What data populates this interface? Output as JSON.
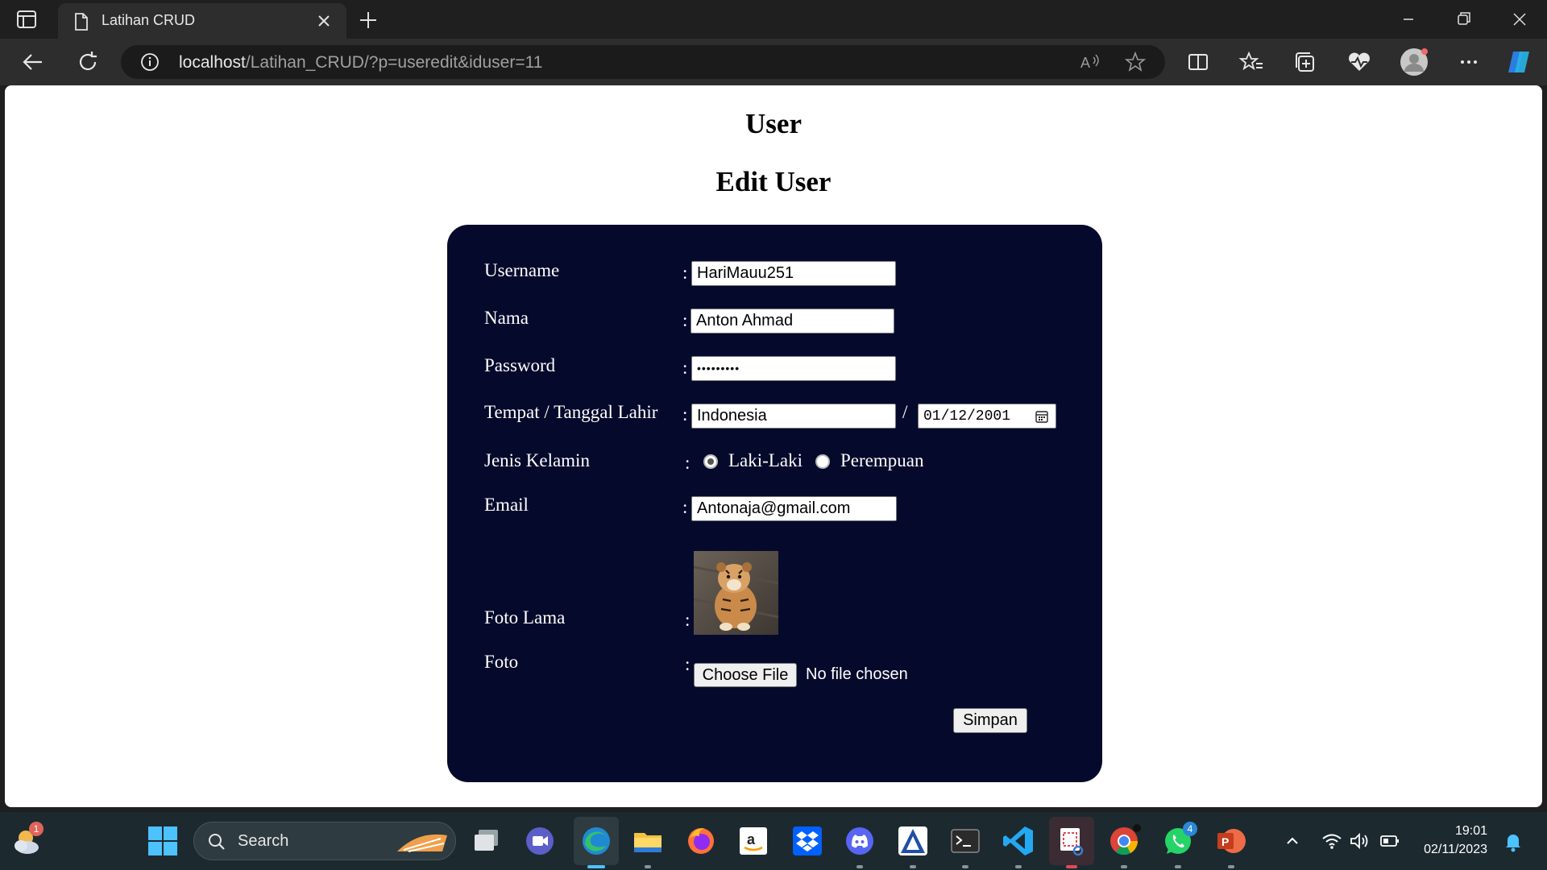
{
  "browser": {
    "tab_title": "Latihan CRUD",
    "url_host": "localhost",
    "url_rest": "/Latihan_CRUD/?p=useredit&iduser=11"
  },
  "page": {
    "heading": "User",
    "subheading": "Edit User"
  },
  "form": {
    "colon": ":",
    "username_label": "Username",
    "username_value": "HariMauu251",
    "nama_label": "Nama",
    "nama_value": "Anton Ahmad",
    "password_label": "Password",
    "password_value": "•••••••••",
    "ttl_label": "Tempat / Tanggal Lahir",
    "tempat_value": "Indonesia",
    "separator": "/",
    "tanggal_value": "01/12/2001",
    "gender_label": "Jenis Kelamin",
    "gender_options": [
      "Laki-Laki",
      "Perempuan"
    ],
    "gender_selected": "Laki-Laki",
    "email_label": "Email",
    "email_value": "Antonaja@gmail.com",
    "foto_lama_label": "Foto Lama",
    "foto_label": "Foto",
    "choose_file_label": "Choose File",
    "no_file_text": "No file chosen",
    "submit_label": "Simpan"
  },
  "taskbar": {
    "search_placeholder": "Search",
    "weather_badge": "1",
    "whatsapp_badge": "4",
    "time": "19:01",
    "date": "02/11/2023"
  },
  "colors": {
    "card_bg": "#050a2c",
    "chrome_bg": "#1f1f1f",
    "taskbar_bg": "#1c2a30"
  }
}
